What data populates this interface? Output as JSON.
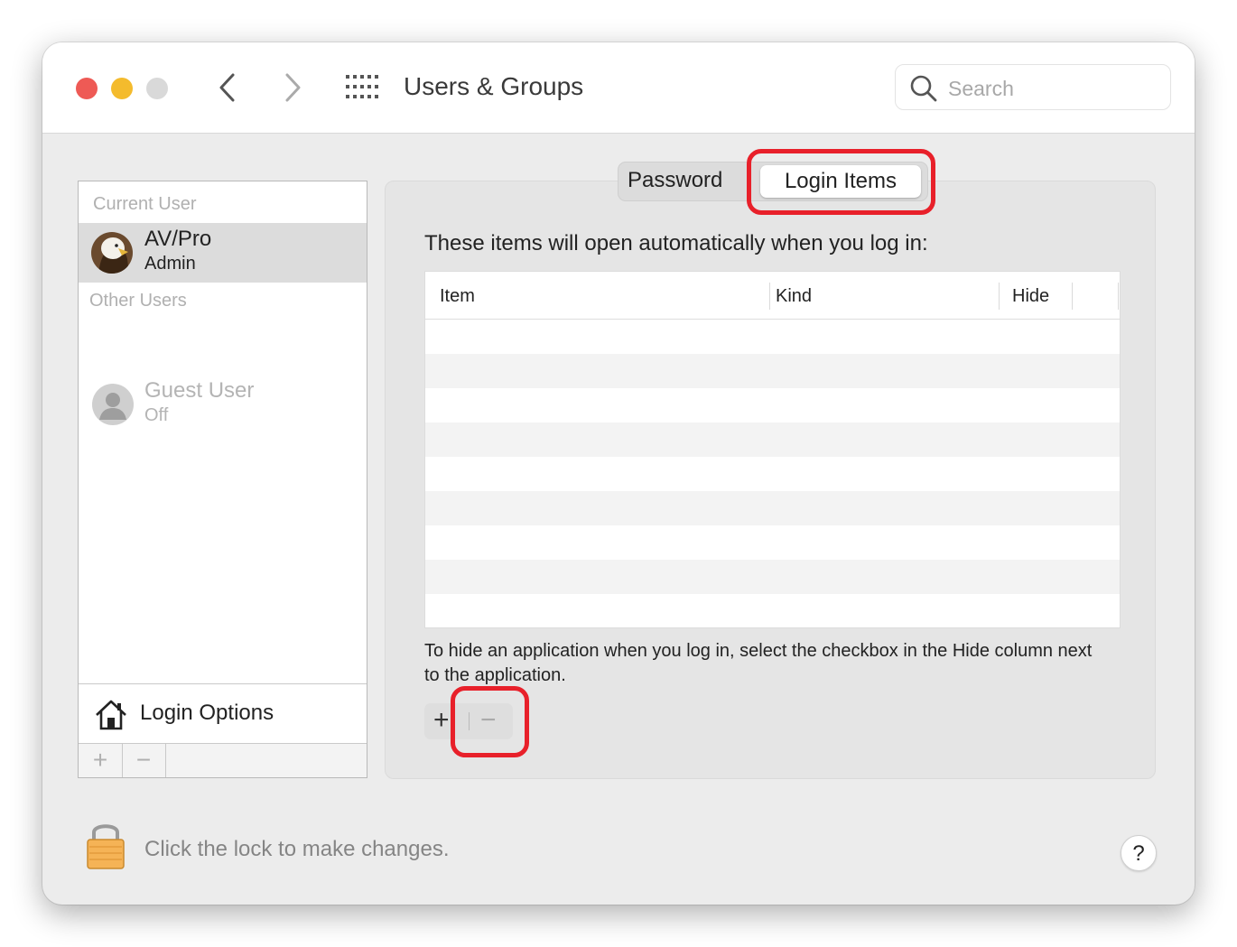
{
  "window": {
    "title": "Users & Groups"
  },
  "search": {
    "placeholder": "Search"
  },
  "sidebar": {
    "current_user_label": "Current User",
    "current_user": {
      "name": "AV/Pro",
      "role": "Admin"
    },
    "other_users_label": "Other Users",
    "guest_user": {
      "name": "Guest User",
      "status": "Off"
    },
    "login_options_label": "Login Options",
    "add_symbol": "+",
    "remove_symbol": "−"
  },
  "tabs": {
    "password": "Password",
    "login_items": "Login Items",
    "selected": "Login Items"
  },
  "login_items": {
    "intro": "These items will open automatically when you log in:",
    "columns": [
      "Item",
      "Kind",
      "Hide"
    ],
    "rows": [],
    "help_text": "To hide an application when you log in, select the checkbox in the Hide column next to the application.",
    "add_symbol": "+",
    "remove_symbol": "−"
  },
  "footer": {
    "lock_text": "Click the lock to make changes.",
    "help_symbol": "?"
  },
  "annotations": {
    "highlight_color": "#e8202a"
  },
  "colors": {
    "close": "#ee5a55",
    "minimize": "#f4bb2d",
    "zoom_disabled": "#d9d9d9"
  }
}
